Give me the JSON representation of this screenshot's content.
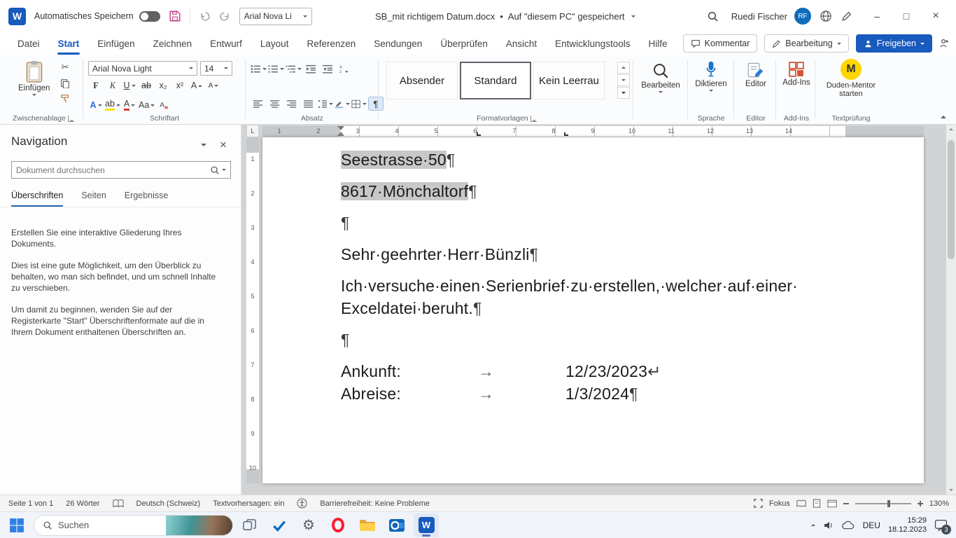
{
  "titlebar": {
    "app_icon": "W",
    "autosave_label": "Automatisches Speichern",
    "quick_font": "Arial Nova Li",
    "doc_title": "SB_mit richtigem Datum.docx",
    "separator": "•",
    "save_status": "Auf \"diesem PC\" gespeichert",
    "user_name": "Ruedi Fischer",
    "user_initials": "RF",
    "minimize": "–",
    "maximize": "□",
    "close": "×"
  },
  "ribbon": {
    "tabs": [
      "Datei",
      "Start",
      "Einfügen",
      "Zeichnen",
      "Entwurf",
      "Layout",
      "Referenzen",
      "Sendungen",
      "Überprüfen",
      "Ansicht",
      "Entwicklungstools",
      "Hilfe"
    ],
    "active_tab_index": 1,
    "comments_button": "Kommentar",
    "editing_mode_button": "Bearbeitung",
    "share_button": "Freigeben",
    "clipboard": {
      "paste": "Einfügen",
      "group_label": "Zwischenablage"
    },
    "font": {
      "family": "Arial Nova Light",
      "size": "14",
      "bold": "F",
      "italic": "K",
      "underline": "U",
      "strikethrough": "ab",
      "subscript": "x₂",
      "superscript": "x²",
      "grow": "A",
      "shrink": "A",
      "effects": "A",
      "highlight_letter": "ab",
      "color": "A",
      "case": "Aa",
      "group_label": "Schriftart"
    },
    "paragraph": {
      "group_label": "Absatz"
    },
    "styles": {
      "items": [
        "Absender",
        "Standard",
        "Kein Leerrau"
      ],
      "selected_index": 1,
      "group_label": "Formatvorlagen"
    },
    "editing": {
      "button": "Bearbeiten"
    },
    "dictate": {
      "button": "Diktieren",
      "group_label": "Sprache"
    },
    "editor": {
      "button": "Editor",
      "group_label": "Editor"
    },
    "addins": {
      "button": "Add-Ins",
      "group_label": "Add-Ins"
    },
    "duden": {
      "button": "Duden-Mentor starten",
      "group_label": "Textprüfung",
      "icon_letter": "M"
    }
  },
  "navigation": {
    "title": "Navigation",
    "search_placeholder": "Dokument durchsuchen",
    "tabs": [
      "Überschriften",
      "Seiten",
      "Ergebnisse"
    ],
    "active_tab_index": 0,
    "paragraphs": [
      "Erstellen Sie eine interaktive Gliederung Ihres Dokuments.",
      "Dies ist eine gute Möglichkeit, um den Überblick zu behalten, wo man sich befindet, und um schnell Inhalte zu verschieben.",
      "Um damit zu beginnen, wenden Sie auf der Registerkarte \"Start\" Überschriftenformate auf die in Ihrem Dokument enthaltenen Überschriften an."
    ]
  },
  "rulers": {
    "horizontal": [
      "1",
      "2",
      "3",
      "4",
      "5",
      "6",
      "7",
      "8",
      "9",
      "10",
      "11",
      "12",
      "13",
      "14"
    ],
    "vertical": [
      "1",
      "2",
      "3",
      "4",
      "5",
      "6",
      "7",
      "8",
      "9",
      "10"
    ]
  },
  "document": {
    "line1": {
      "text": "Seestrasse·50",
      "mark": "¶"
    },
    "line2": {
      "text": "8617·Mönchaltorf",
      "mark": "¶"
    },
    "line3": {
      "mark": "¶"
    },
    "line4": {
      "text": "Sehr·geehrter·Herr·Bünzli",
      "mark": "¶"
    },
    "line5a": "Ich·versuche·einen·Serienbrief·zu·erstellen,·welcher·auf·einer·",
    "line5b": {
      "text": "Exceldatei·beruht.",
      "mark": "¶"
    },
    "line6": {
      "mark": "¶"
    },
    "line7": {
      "label": "Ankunft:",
      "tab": "→",
      "value": "12/23/2023",
      "mark": "↵"
    },
    "line8": {
      "label": "Abreise:",
      "tab": "→",
      "value": "1/3/2024",
      "mark": "¶"
    }
  },
  "statusbar": {
    "page": "Seite 1 von 1",
    "words": "26 Wörter",
    "language": "Deutsch (Schweiz)",
    "predictions": "Textvorhersagen: ein",
    "accessibility": "Barrierefreiheit: Keine Probleme",
    "focus": "Fokus",
    "zoom": "130%"
  },
  "taskbar": {
    "search_placeholder": "Suchen",
    "word_glyph": "W",
    "language": "DEU",
    "time": "15:29",
    "date": "18.12.2023",
    "notification_count": "3"
  }
}
